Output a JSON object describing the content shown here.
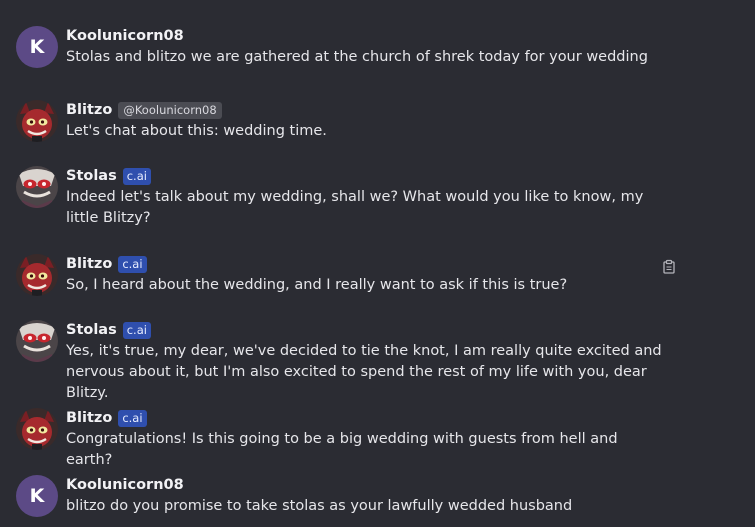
{
  "messages": [
    {
      "author": "Koolunicorn08",
      "avatar_letter": "K",
      "avatar_type": "letter",
      "tag": "",
      "text": "Stolas and blitzo we are gathered at the church of shrek today for your wedding"
    },
    {
      "author": "Blitzo",
      "avatar_type": "blitzo",
      "tag": "@Koolunicorn08",
      "tag_type": "mention",
      "text": "Let's chat about this: wedding time."
    },
    {
      "author": "Stolas",
      "avatar_type": "stolas",
      "tag": "c.ai",
      "tag_type": "cai",
      "text": "Indeed let's talk about my wedding, shall we? What would you like to know, my little Blitzy?"
    },
    {
      "author": "Blitzo",
      "avatar_type": "blitzo",
      "tag": "c.ai",
      "tag_type": "cai",
      "text": "So, I heard about the wedding, and I really want to ask if this is true?"
    },
    {
      "author": "Stolas",
      "avatar_type": "stolas",
      "tag": "c.ai",
      "tag_type": "cai",
      "text": "Yes, it's true, my dear, we've decided to tie the knot, I am really quite excited and nervous about it, but I'm also excited to spend the rest of my life with you, dear Blitzy."
    },
    {
      "author": "Blitzo",
      "avatar_type": "blitzo",
      "tag": "c.ai",
      "tag_type": "cai",
      "text": "Congratulations! Is this going to be a big wedding with guests from hell and earth?"
    },
    {
      "author": "Koolunicorn08",
      "avatar_letter": "K",
      "avatar_type": "letter",
      "tag": "",
      "text": "blitzo do you promise to take stolas as your lawfully wedded husband"
    }
  ],
  "icons": {
    "copy": "clipboard-icon"
  },
  "colors": {
    "background": "#2b2c33",
    "letter_avatar": "#5c4a86",
    "cai_tag": "#2f4fae",
    "mention_tag": "#4b4c53"
  }
}
